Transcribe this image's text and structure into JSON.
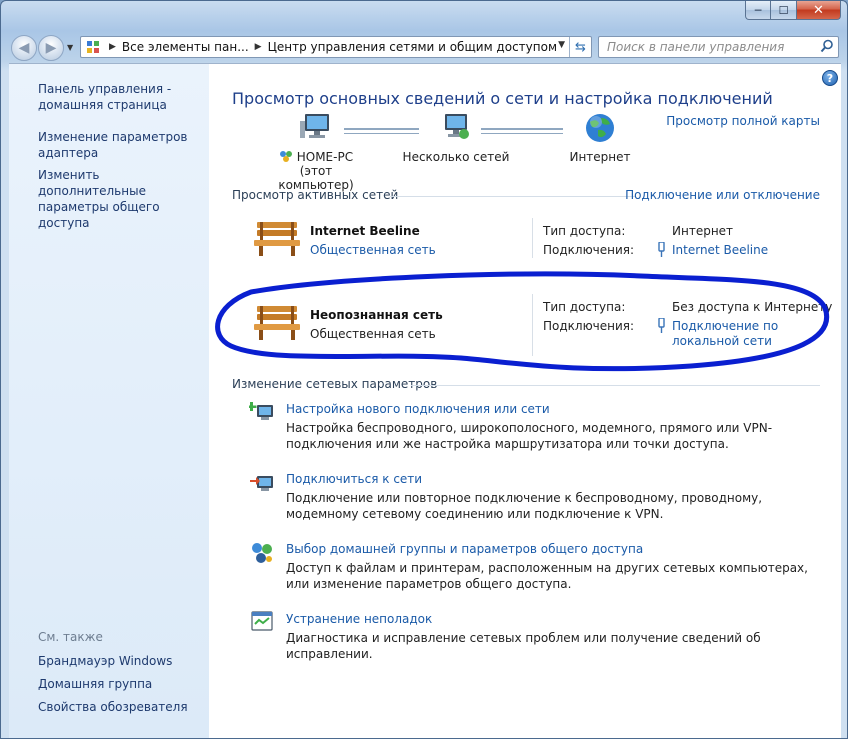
{
  "window": {
    "caption": {
      "minimize": "─",
      "maximize": "☐",
      "close": "✕"
    }
  },
  "nav": {
    "back_icon": "back-arrow",
    "forward_icon": "forward-arrow",
    "address": {
      "crumbs": [
        "Все элементы пан...",
        "Центр управления сетями и общим доступом"
      ]
    },
    "search_placeholder": "Поиск в панели управления"
  },
  "sidebar": {
    "links": [
      "Панель управления -\nдомашняя страница",
      "Изменение параметров\nадаптера",
      "Изменить дополнительные\nпараметры общего доступа"
    ],
    "see_also_title": "См. также",
    "see_also": [
      "Брандмауэр Windows",
      "Домашняя группа",
      "Свойства обозревателя"
    ]
  },
  "main": {
    "title": "Просмотр основных сведений о сети и настройка подключений",
    "full_map_link": "Просмотр полной карты",
    "map": {
      "computer_name": "HOME-PC",
      "computer_sub": "(этот компьютер)",
      "networks": "Несколько сетей",
      "internet": "Интернет"
    },
    "active_title": "Просмотр активных сетей",
    "connect_link": "Подключение или отключение",
    "networks": [
      {
        "name": "Internet Beeline",
        "type": "Общественная сеть",
        "access_label": "Тип доступа:",
        "access_value": "Интернет",
        "conn_label": "Подключения:",
        "conn_value": "Internet Beeline"
      },
      {
        "name": "Неопознанная сеть",
        "type": "Общественная сеть",
        "access_label": "Тип доступа:",
        "access_value": "Без доступа к Интернету",
        "conn_label": "Подключения:",
        "conn_value_1": "Подключение по",
        "conn_value_2": "локальной сети"
      }
    ],
    "change_title": "Изменение сетевых параметров",
    "tasks": [
      {
        "link": "Настройка нового подключения или сети",
        "desc": "Настройка беспроводного, широкополосного, модемного, прямого или VPN-подключения или же настройка маршрутизатора или точки доступа."
      },
      {
        "link": "Подключиться к сети",
        "desc": "Подключение или повторное подключение к беспроводному, проводному, модемному сетевому соединению или подключение к VPN."
      },
      {
        "link": "Выбор домашней группы и параметров общего доступа",
        "desc": "Доступ к файлам и принтерам, расположенным на других сетевых компьютерах, или изменение параметров общего доступа."
      },
      {
        "link": "Устранение неполадок",
        "desc": "Диагностика и исправление сетевых проблем или получение сведений об исправлении."
      }
    ]
  },
  "colors": {
    "link": "#1a5aa8",
    "title": "#1e3f8a",
    "highlight": "#0a1fd0"
  }
}
